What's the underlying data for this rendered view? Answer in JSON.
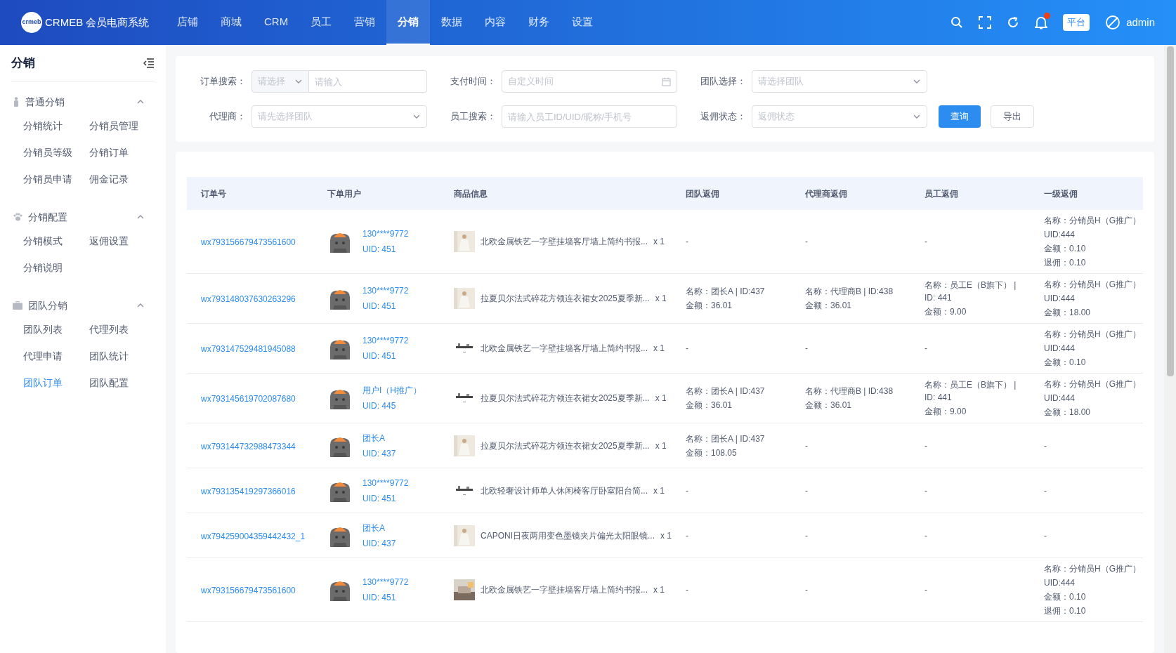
{
  "header": {
    "brand": {
      "logo": "crmeb",
      "title": "CRMEB 会员电商系统"
    },
    "nav": [
      {
        "label": "店铺",
        "selected": false
      },
      {
        "label": "商城",
        "selected": false
      },
      {
        "label": "CRM",
        "selected": false
      },
      {
        "label": "员工",
        "selected": false
      },
      {
        "label": "营销",
        "selected": false
      },
      {
        "label": "分销",
        "selected": true
      },
      {
        "label": "数据",
        "selected": false
      },
      {
        "label": "内容",
        "selected": false
      },
      {
        "label": "财务",
        "selected": false
      },
      {
        "label": "设置",
        "selected": false
      }
    ],
    "has_notification": true,
    "platform_badge": "平台",
    "user": "admin"
  },
  "sidebar": {
    "title": "分销",
    "groups": [
      {
        "title": "普通分销",
        "expanded": true,
        "items": [
          {
            "label": "分销统计",
            "selected": false
          },
          {
            "label": "分销员管理",
            "selected": false
          },
          {
            "label": "分销员等级",
            "selected": false
          },
          {
            "label": "分销订单",
            "selected": false
          },
          {
            "label": "分销员申请",
            "selected": false
          },
          {
            "label": "佣金记录",
            "selected": false
          }
        ]
      },
      {
        "title": "分销配置",
        "expanded": true,
        "items": [
          {
            "label": "分销模式",
            "selected": false
          },
          {
            "label": "返佣设置",
            "selected": false
          },
          {
            "label": "分销说明",
            "selected": false
          }
        ]
      },
      {
        "title": "团队分销",
        "expanded": true,
        "items": [
          {
            "label": "团队列表",
            "selected": false
          },
          {
            "label": "代理列表",
            "selected": false
          },
          {
            "label": "代理申请",
            "selected": false
          },
          {
            "label": "团队统计",
            "selected": false
          },
          {
            "label": "团队订单",
            "selected": true
          },
          {
            "label": "团队配置",
            "selected": false
          }
        ]
      }
    ]
  },
  "filters": [
    {
      "label": "订单搜索：",
      "kind": "select-input",
      "select": "请选择",
      "placeholder": "请输入"
    },
    {
      "label": "支付时间：",
      "kind": "date",
      "placeholder": "自定义时间"
    },
    {
      "label": "团队选择：",
      "kind": "select",
      "placeholder": "请选择团队"
    },
    {
      "label": "代理商：",
      "kind": "select",
      "placeholder": "请先选择团队"
    },
    {
      "label": "员工搜索：",
      "kind": "input",
      "placeholder": "请输入员工ID/UID/昵称/手机号"
    },
    {
      "label": "返佣状态：",
      "kind": "select",
      "placeholder": "返佣状态"
    }
  ],
  "buttons": [
    {
      "label": "查询",
      "kind": "primary"
    },
    {
      "label": "导出",
      "kind": "default"
    }
  ],
  "table": {
    "columns": [
      "订单号",
      "下单用户",
      "商品信息",
      "团队返佣",
      "代理商返佣",
      "员工返佣",
      "一级返佣"
    ],
    "rows": [
      {
        "order": "wx793156679473561600",
        "user": [
          "130****9772",
          "UID: 451"
        ],
        "product": "北欧金属铁艺一字壁挂墙客厅墙上简约书报...",
        "qty": "x 1",
        "team": [
          "-"
        ],
        "agent": [
          "-"
        ],
        "staff": [
          "-"
        ],
        "level1": [
          "名称：分销员H（G推广）",
          "UID:444",
          "金额：0.10",
          "退佣：0.10"
        ]
      },
      {
        "order": "wx793148037630263296",
        "user": [
          "130****9772",
          "UID: 451"
        ],
        "product": "拉夏贝尔法式碎花方领连衣裙女2025夏季新...",
        "qty": "x 1",
        "team": [
          "名称：团长A | ID:437",
          "金额：36.01"
        ],
        "agent": [
          "名称：代理商B | ID:438",
          "金额：36.01"
        ],
        "staff": [
          "名称：员工E（B旗下） | ID: 441",
          "金额：9.00"
        ],
        "level1": [
          "名称：分销员H（G推广）",
          "UID:444",
          "金额：18.00"
        ]
      },
      {
        "order": "wx793147529481945088",
        "user": [
          "130****9772",
          "UID: 451"
        ],
        "product": "北欧金属铁艺一字壁挂墙客厅墙上简约书报...",
        "qty": "x 1",
        "team": [
          "-"
        ],
        "agent": [
          "-"
        ],
        "staff": [
          "-"
        ],
        "level1": [
          "名称：分销员H（G推广）",
          "UID:444",
          "金额：0.10"
        ]
      },
      {
        "order": "wx793145619702087680",
        "user": [
          "用户I（H推广）",
          "UID: 445"
        ],
        "product": "拉夏贝尔法式碎花方领连衣裙女2025夏季新...",
        "qty": "x 1",
        "team": [
          "名称：团长A | ID:437",
          "金额：36.01"
        ],
        "agent": [
          "名称：代理商B | ID:438",
          "金额：36.01"
        ],
        "staff": [
          "名称：员工E（B旗下） | ID: 441",
          "金额：9.00"
        ],
        "level1": [
          "名称：分销员H（G推广）",
          "UID:444",
          "金额：18.00"
        ]
      },
      {
        "order": "wx793144732988473344",
        "user": [
          "团长A",
          "UID: 437"
        ],
        "product": "拉夏贝尔法式碎花方领连衣裙女2025夏季新...",
        "qty": "x 1",
        "team": [
          "名称：团长A | ID:437",
          "金额：108.05"
        ],
        "agent": [
          "-"
        ],
        "staff": [
          "-"
        ],
        "level1": [
          "-"
        ]
      },
      {
        "order": "wx793135419297366016",
        "user": [
          "130****9772",
          "UID: 451"
        ],
        "product": "北欧轻奢设计师单人休闲椅客厅卧室阳台简...",
        "qty": "x 1",
        "team": [
          "-"
        ],
        "agent": [
          "-"
        ],
        "staff": [
          "-"
        ],
        "level1": [
          "-"
        ]
      },
      {
        "order": "wx794259004359442432_1",
        "user": [
          "团长A",
          "UID: 437"
        ],
        "product": "CAPONI日夜两用变色墨镜夹片偏光太阳眼镜...",
        "qty": "x 1",
        "team": [
          "-"
        ],
        "agent": [
          "-"
        ],
        "staff": [
          "-"
        ],
        "level1": [
          "-"
        ]
      },
      {
        "order": "wx793156679473561600",
        "user": [
          "130****9772",
          "UID: 451"
        ],
        "product": "北欧金属铁艺一字壁挂墙客厅墙上简约书报...",
        "qty": "x 1",
        "team": [
          "-"
        ],
        "agent": [
          "-"
        ],
        "staff": [
          "-"
        ],
        "level1": [
          "名称：分销员H（G推广）",
          "UID:444",
          "金额：0.10",
          "退佣：0.10"
        ]
      }
    ]
  }
}
